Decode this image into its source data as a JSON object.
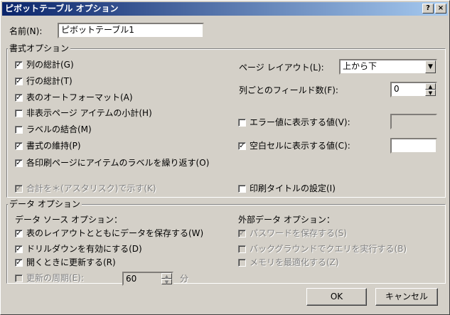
{
  "title": "ピボットテーブル オプション",
  "title_buttons": {
    "help": "?",
    "close": "×"
  },
  "name": {
    "label": "名前(N):",
    "value": "ピボットテーブル1"
  },
  "format_group": {
    "title": "書式オプション",
    "left": [
      {
        "label": "列の総計(G)",
        "checked": true,
        "disabled": false
      },
      {
        "label": "行の総計(T)",
        "checked": true,
        "disabled": false
      },
      {
        "label": "表のオートフォーマット(A)",
        "checked": true,
        "disabled": false
      },
      {
        "label": "非表示ページ アイテムの小計(H)",
        "checked": false,
        "disabled": false
      },
      {
        "label": "ラベルの結合(M)",
        "checked": false,
        "disabled": false
      },
      {
        "label": "書式の維持(P)",
        "checked": true,
        "disabled": false
      },
      {
        "label": "各印刷ページにアイテムのラベルを繰り返す(O)",
        "checked": true,
        "disabled": false
      },
      {
        "label": "合計を＊(アスタリスク)で示す(K)",
        "checked": true,
        "disabled": true
      }
    ],
    "page_layout": {
      "label": "ページ レイアウト(L):",
      "value": "上から下"
    },
    "fields_per_col": {
      "label": "列ごとのフィールド数(F):",
      "value": "0"
    },
    "error_values": {
      "label": "エラー値に表示する値(V):",
      "checked": false,
      "value": ""
    },
    "empty_cells": {
      "label": "空白セルに表示する値(C):",
      "checked": true,
      "value": ""
    },
    "print_titles": {
      "label": "印刷タイトルの設定(I)",
      "checked": false
    }
  },
  "data_group": {
    "title": "データ オプション",
    "source_title": "データ ソース オプション：",
    "source": [
      {
        "label": "表のレイアウトとともにデータを保存する(W)",
        "checked": true,
        "disabled": false
      },
      {
        "label": "ドリルダウンを有効にする(D)",
        "checked": true,
        "disabled": false
      },
      {
        "label": "開くときに更新する(R)",
        "checked": true,
        "disabled": false
      },
      {
        "label": "更新の周期(E):",
        "checked": false,
        "disabled": true
      }
    ],
    "refresh_minutes": "60",
    "minutes_unit": "分",
    "external_title": "外部データ オプション：",
    "external": [
      {
        "label": "パスワードを保存する(S)",
        "checked": true,
        "disabled": true
      },
      {
        "label": "バックグラウンドでクエリを実行する(B)",
        "checked": false,
        "disabled": true
      },
      {
        "label": "メモリを最適化する(Z)",
        "checked": false,
        "disabled": true
      }
    ]
  },
  "buttons": {
    "ok": "OK",
    "cancel": "キャンセル"
  }
}
